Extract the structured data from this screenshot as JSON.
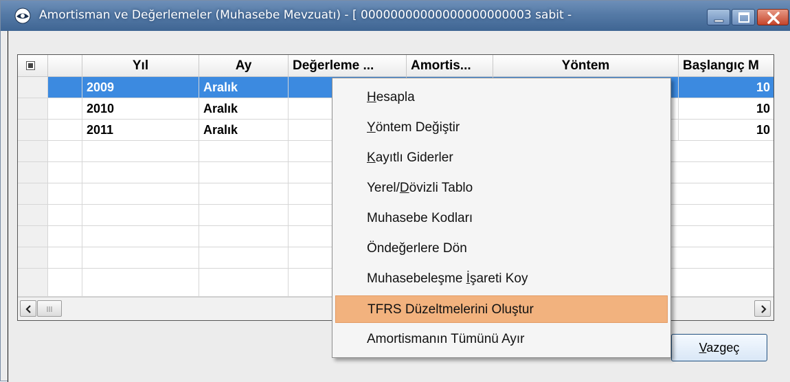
{
  "window": {
    "title": "Amortisman ve Değerlemeler (Muhasebe Mevzuatı) -  [ 00000000000000000000003 sabit - "
  },
  "grid": {
    "columns": [
      {
        "label": "Yıl"
      },
      {
        "label": "Ay"
      },
      {
        "label": "Değerleme ..."
      },
      {
        "label": "Amortis..."
      },
      {
        "label": "Yöntem"
      },
      {
        "label": "Başlangıç M"
      }
    ],
    "rows": [
      {
        "yil": "2009",
        "ay": "Aralık",
        "baslangic": "10"
      },
      {
        "yil": "2010",
        "ay": "Aralık",
        "baslangic": "10"
      },
      {
        "yil": "2011",
        "ay": "Aralık",
        "baslangic": "10"
      }
    ],
    "selected_row": 0
  },
  "context_menu": {
    "items": [
      {
        "label": "Hesapla",
        "accel_index": 0
      },
      {
        "label": "Yöntem Değiştir",
        "accel_index": 0
      },
      {
        "label": "Kayıtlı Giderler",
        "accel_index": 0
      },
      {
        "label": "Yerel/Dövizli Tablo",
        "accel_index": 6
      },
      {
        "label": "Muhasebe Kodları",
        "accel_index": -1
      },
      {
        "label": "Öndeğerlere Dön",
        "accel_index": -1
      },
      {
        "label": "Muhasebeleşme İşareti Koy",
        "accel_index": 14
      },
      {
        "label": "TFRS Düzeltmelerini Oluştur",
        "accel_index": -1
      },
      {
        "label": "Amortismanın Tümünü Ayır",
        "accel_index": -1
      }
    ],
    "highlighted_index": 7
  },
  "buttons": {
    "cancel_first": "V",
    "cancel_rest": "azgeç"
  },
  "colors": {
    "titlebar": "#557aa6",
    "selection": "#3c8ae0",
    "menu_highlight": "#f2b27e"
  }
}
